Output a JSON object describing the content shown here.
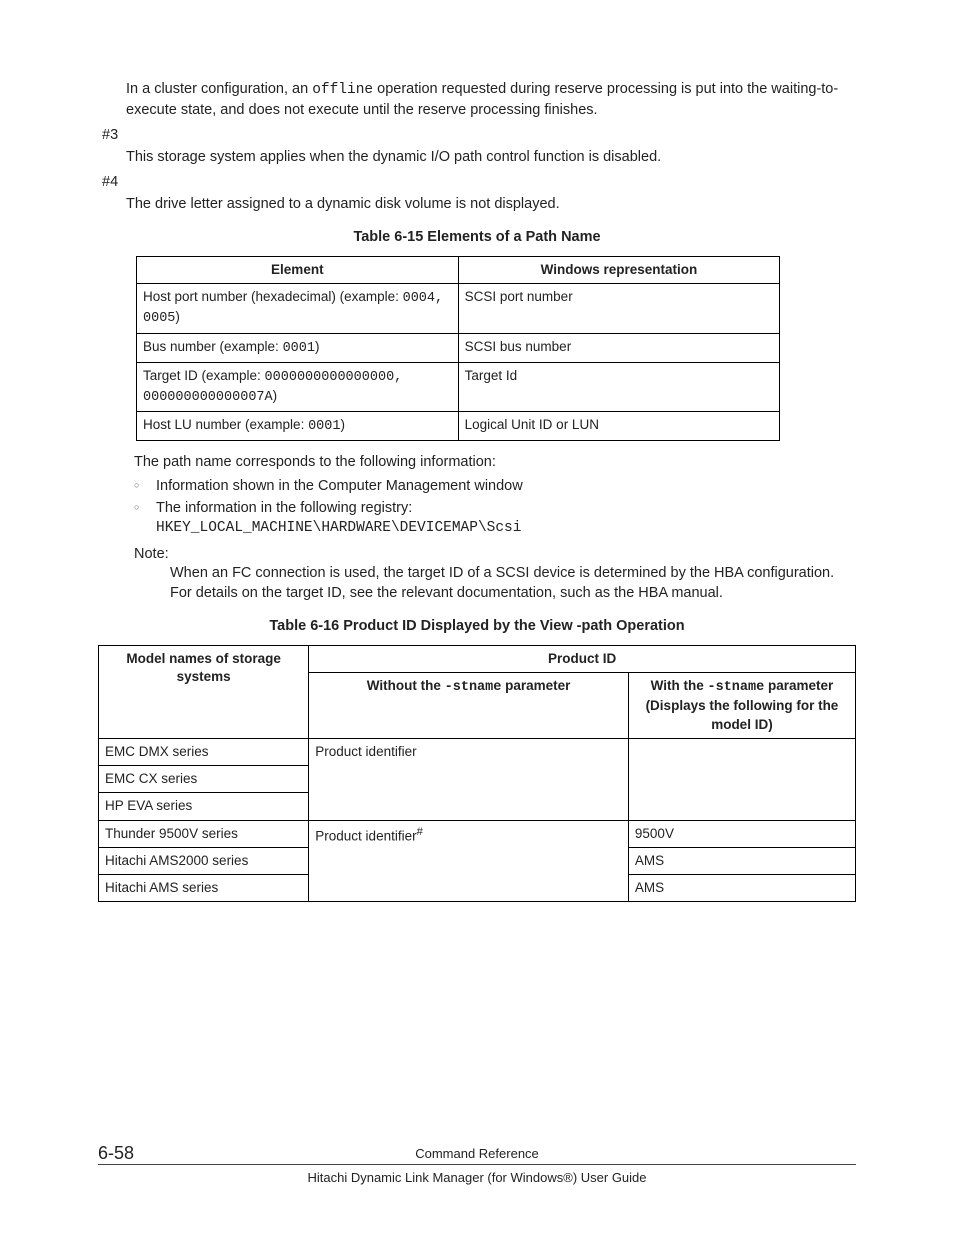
{
  "para_cluster": {
    "p1_a": "In a cluster configuration, an ",
    "p1_code": "offline",
    "p1_b": " operation requested during reserve processing is put into the waiting-to-execute state, and does not execute until the reserve processing finishes."
  },
  "hash3_label": "#3",
  "hash3_text": "This storage system applies when the dynamic I/O path control function is disabled.",
  "hash4_label": "#4",
  "hash4_text": "The drive letter assigned to a dynamic disk volume is not displayed.",
  "table15": {
    "title": "Table 6-15 Elements of a Path Name",
    "headers": {
      "c1": "Element",
      "c2": "Windows representation"
    },
    "rows": [
      {
        "c1_a": "Host port number (hexadecimal) (example: ",
        "c1_code": "0004, 0005",
        "c1_b": ")",
        "c2": "SCSI port number"
      },
      {
        "c1_a": "Bus number (example: ",
        "c1_code": "0001",
        "c1_b": ")",
        "c2": "SCSI bus number"
      },
      {
        "c1_a": "Target ID (example: ",
        "c1_code": "0000000000000000, 000000000000007A",
        "c1_b": ")",
        "c2": "Target Id"
      },
      {
        "c1_a": "Host LU number (example: ",
        "c1_code": "0001",
        "c1_b": ")",
        "c2": "Logical Unit ID or LUN"
      }
    ]
  },
  "para_pathname": "The path name corresponds to the following information:",
  "bullets": {
    "b1": "Information shown in the Computer Management window",
    "b2": "The information in the following registry:",
    "b2_code": "HKEY_LOCAL_MACHINE\\HARDWARE\\DEVICEMAP\\Scsi"
  },
  "note_label": "Note:",
  "note_text": "When an FC connection is used, the target ID of a SCSI device is determined by the HBA configuration. For details on the target ID, see the relevant documentation, such as the HBA manual.",
  "table16": {
    "title": "Table 6-16 Product ID Displayed by the View -path Operation",
    "headers": {
      "model": "Model names of storage systems",
      "pid": "Product ID",
      "without_a": "Without the ",
      "without_code": "-stname",
      "without_b": " parameter",
      "with_a": "With the ",
      "with_code": "-stname",
      "with_b": " parameter (Displays the following for the model ID)"
    },
    "rows": [
      {
        "model": "EMC DMX series",
        "without": "Product identifier",
        "with": ""
      },
      {
        "model": "EMC CX series",
        "without": "",
        "with": ""
      },
      {
        "model": "HP EVA series",
        "without": "",
        "with": ""
      },
      {
        "model": "Thunder 9500V series",
        "without_a": "Product identifier",
        "without_sup": "#",
        "with": "9500V"
      },
      {
        "model": "Hitachi AMS2000 series",
        "without": "",
        "with": "AMS"
      },
      {
        "model": "Hitachi AMS series",
        "without": "",
        "with": "AMS"
      }
    ]
  },
  "footer": {
    "pagenum": "6-58",
    "section": "Command Reference",
    "doc": "Hitachi Dynamic Link Manager (for Windows®) User Guide"
  }
}
